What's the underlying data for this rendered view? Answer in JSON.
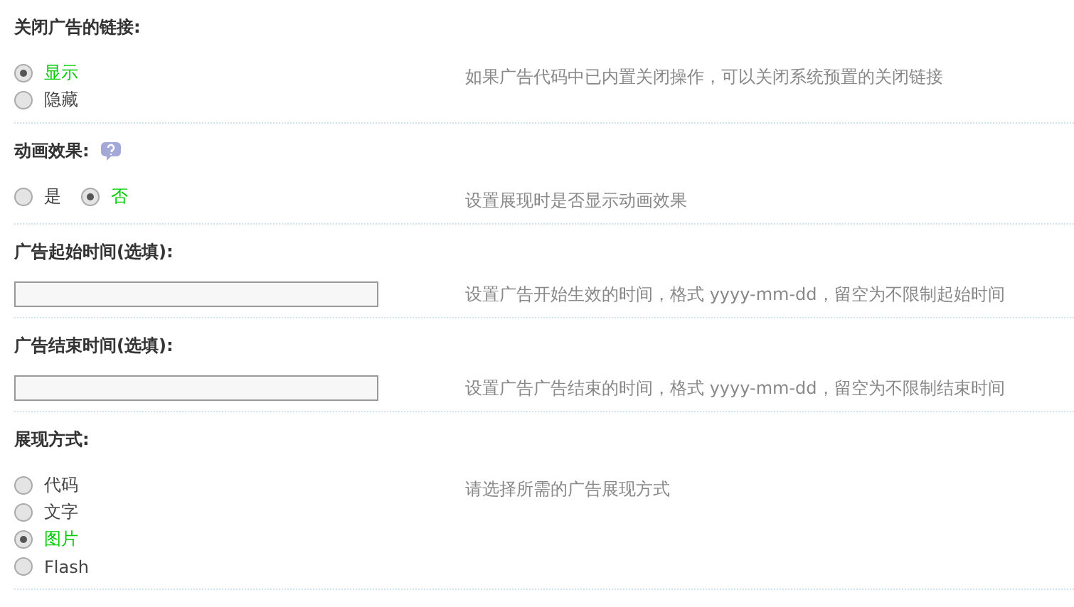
{
  "settings": [
    {
      "kind": "radio_stacked",
      "title": "关闭广告的链接:",
      "help": false,
      "description": "如果广告代码中已内置关闭操作，可以关闭系统预置的关闭链接",
      "options": [
        {
          "label": "显示",
          "selected": true
        },
        {
          "label": "隐藏",
          "selected": false
        }
      ]
    },
    {
      "kind": "radio_inline",
      "title": "动画效果:",
      "help": true,
      "description": "设置展现时是否显示动画效果",
      "options": [
        {
          "label": "是",
          "selected": false
        },
        {
          "label": "否",
          "selected": true
        }
      ]
    },
    {
      "kind": "text",
      "title": "广告起始时间(选填):",
      "help": false,
      "description": "设置广告开始生效的时间，格式 yyyy-mm-dd，留空为不限制起始时间"
    },
    {
      "kind": "text",
      "title": "广告结束时间(选填):",
      "help": false,
      "description": "设置广告广告结束的时间，格式 yyyy-mm-dd，留空为不限制结束时间"
    },
    {
      "kind": "radio_stacked",
      "title": "展现方式:",
      "help": false,
      "description": "请选择所需的广告展现方式",
      "options": [
        {
          "label": "代码",
          "selected": false
        },
        {
          "label": "文字",
          "selected": false
        },
        {
          "label": "图片",
          "selected": true
        },
        {
          "label": "Flash",
          "selected": false
        }
      ]
    }
  ]
}
